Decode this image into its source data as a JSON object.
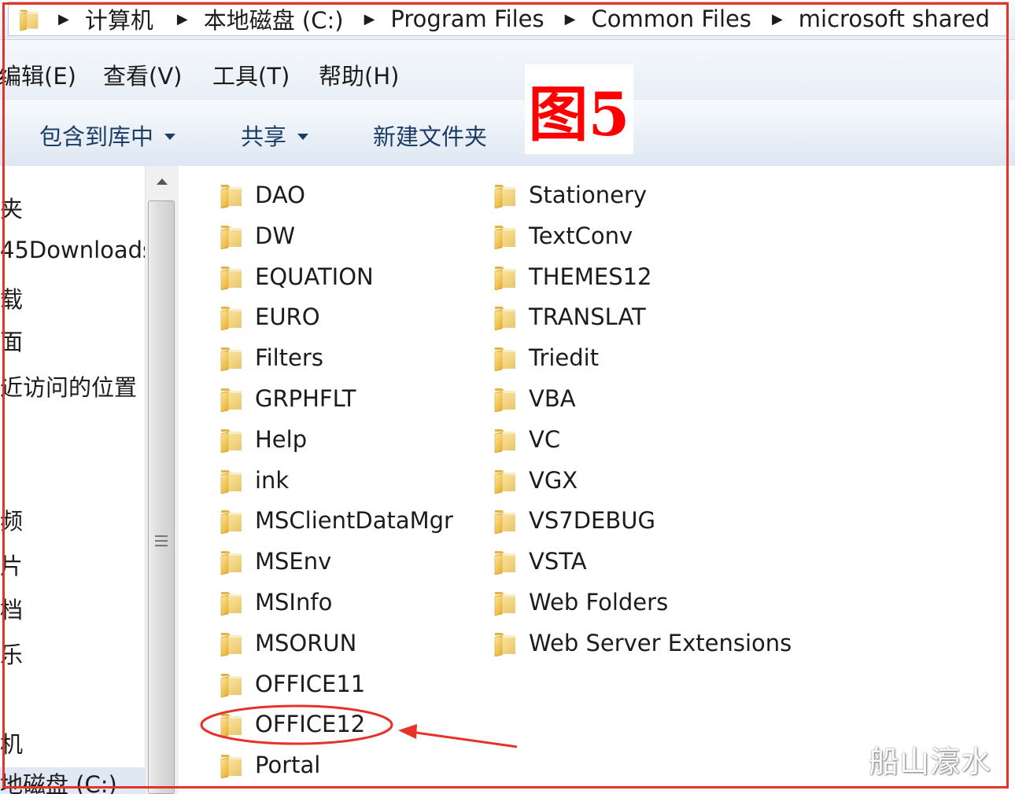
{
  "address_bar": {
    "breadcrumbs": [
      "计算机",
      "本地磁盘 (C:)",
      "Program Files",
      "Common Files",
      "microsoft shared"
    ]
  },
  "menu": {
    "items": [
      "编辑(E)",
      "查看(V)",
      "工具(T)",
      "帮助(H)"
    ]
  },
  "toolbar": {
    "include_library": "包含到库中",
    "share": "共享",
    "new_folder": "新建文件夹"
  },
  "annotation": {
    "figure_label": "图5",
    "watermark": "船山濠水"
  },
  "nav_pane": {
    "items": [
      "夹",
      "45Downloads",
      "载",
      "面",
      "近访问的位置",
      "频",
      "片",
      "档",
      "乐",
      "机",
      "地磁盘 (C:)"
    ]
  },
  "files": {
    "column1": [
      "DAO",
      "DW",
      "EQUATION",
      "EURO",
      "Filters",
      "GRPHFLT",
      "Help",
      "ink",
      "MSClientDataMgr",
      "MSEnv",
      "MSInfo",
      "MSORUN",
      "OFFICE11",
      "OFFICE12",
      "Portal"
    ],
    "column2": [
      "Stationery",
      "TextConv",
      "THEMES12",
      "TRANSLAT",
      "Triedit",
      "VBA",
      "VC",
      "VGX",
      "VS7DEBUG",
      "VSTA",
      "Web Folders",
      "Web Server Extensions"
    ]
  },
  "colors": {
    "annotation_red": "#e5332a",
    "folder_yellow": "#f2c94c",
    "toolbar_text": "#1e3d66"
  },
  "icons": {
    "folder": "folder-icon",
    "breadcrumb_separator": "chevron-right-icon",
    "dropdown": "caret-down-icon"
  }
}
